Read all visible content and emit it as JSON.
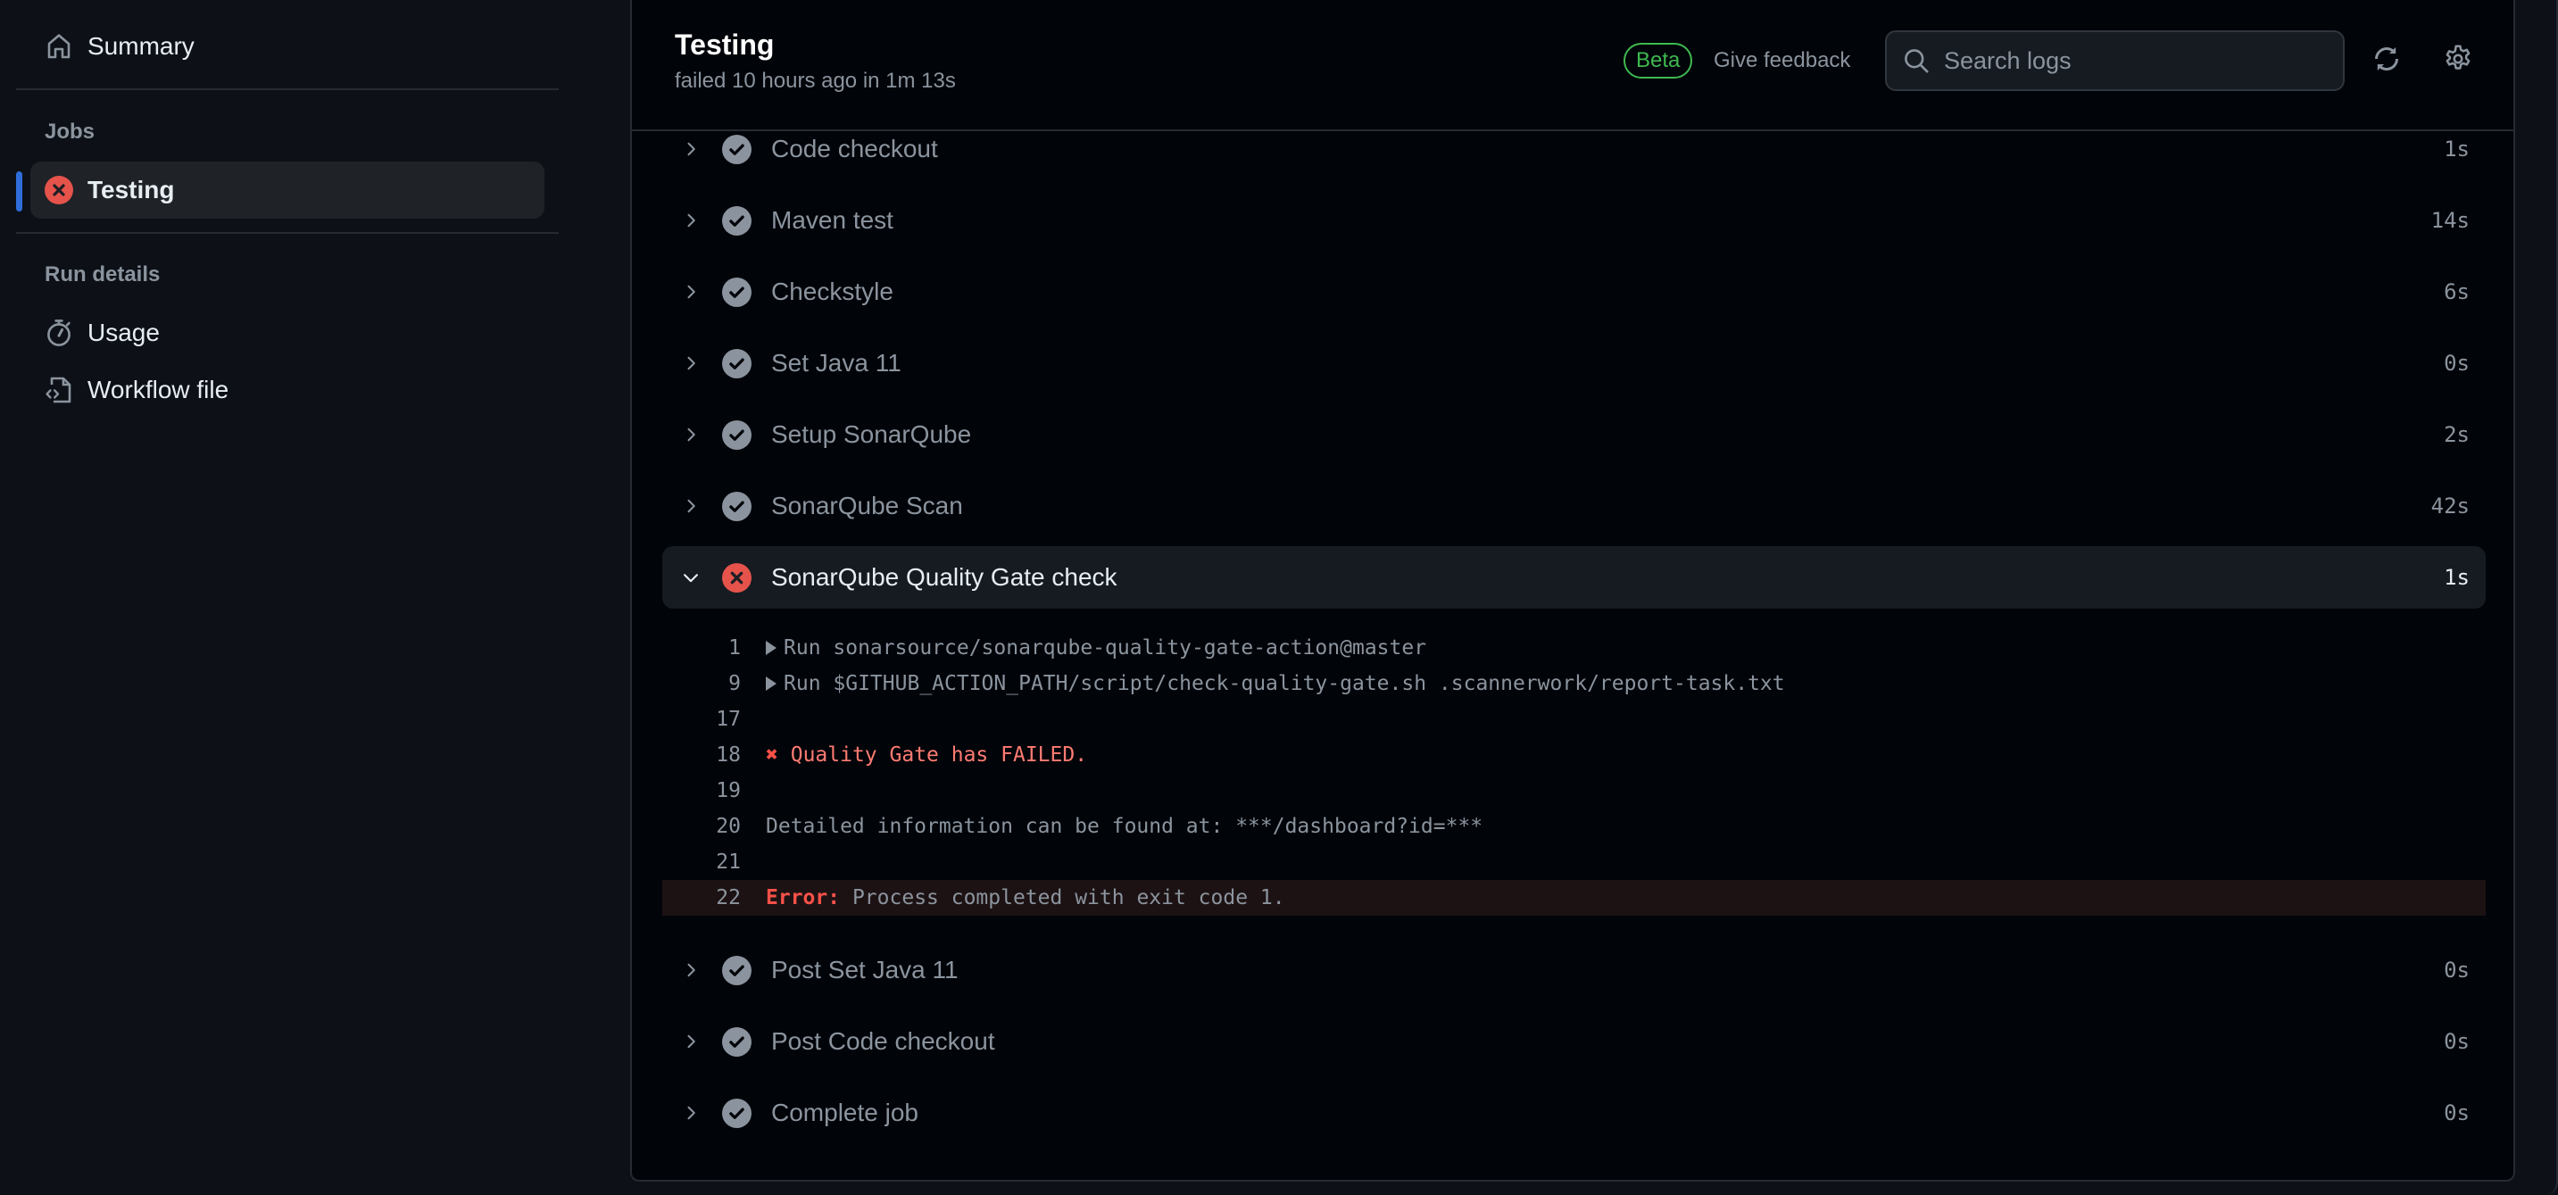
{
  "sidebar": {
    "summary": {
      "label": "Summary",
      "icon": "home-icon"
    },
    "jobs_heading": "Jobs",
    "jobs": [
      {
        "label": "Testing",
        "status": "failed",
        "icon": "x-circle-fill-icon",
        "active": true
      }
    ],
    "run_details_heading": "Run details",
    "run_details": [
      {
        "label": "Usage",
        "icon": "stopwatch-icon"
      },
      {
        "label": "Workflow file",
        "icon": "file-code-icon"
      }
    ]
  },
  "header": {
    "title": "Testing",
    "subtitle": "failed 10 hours ago in 1m 13s",
    "beta_label": "Beta",
    "feedback_label": "Give feedback",
    "search_placeholder": "Search logs",
    "refresh_icon": "sync-icon",
    "settings_icon": "gear-icon"
  },
  "steps_before": [
    {
      "name": "Code checkout",
      "duration": "1s",
      "status": "success"
    },
    {
      "name": "Maven test",
      "duration": "14s",
      "status": "success"
    },
    {
      "name": "Checkstyle",
      "duration": "6s",
      "status": "success"
    },
    {
      "name": "Set Java 11",
      "duration": "0s",
      "status": "success"
    },
    {
      "name": "Setup SonarQube",
      "duration": "2s",
      "status": "success"
    },
    {
      "name": "SonarQube Scan",
      "duration": "42s",
      "status": "success"
    }
  ],
  "expanded_step": {
    "name": "SonarQube Quality Gate check",
    "duration": "1s",
    "status": "failure",
    "log": [
      {
        "line": "1",
        "text": "Run sonarsource/sonarqube-quality-gate-action@master",
        "collapsible": true
      },
      {
        "line": "9",
        "text": "Run $GITHUB_ACTION_PATH/script/check-quality-gate.sh .scannerwork/report-task.txt",
        "collapsible": true
      },
      {
        "line": "17",
        "text": ""
      },
      {
        "line": "18",
        "mark": "✖",
        "text": "Quality Gate has FAILED.",
        "style": "error"
      },
      {
        "line": "19",
        "text": ""
      },
      {
        "line": "20",
        "text": "Detailed information can be found at: ***/dashboard?id=***"
      },
      {
        "line": "21",
        "text": ""
      },
      {
        "line": "22",
        "error_label": "Error:",
        "text": "Process completed with exit code 1.",
        "style": "error-line"
      }
    ]
  },
  "steps_after": [
    {
      "name": "Post Set Java 11",
      "duration": "0s",
      "status": "success"
    },
    {
      "name": "Post Code checkout",
      "duration": "0s",
      "status": "success"
    },
    {
      "name": "Complete job",
      "duration": "0s",
      "status": "success"
    }
  ],
  "colors": {
    "failure": "#e5534b",
    "success_icon": "#8b949e",
    "accent": "#2f6ddb",
    "beta": "#3fb950"
  }
}
